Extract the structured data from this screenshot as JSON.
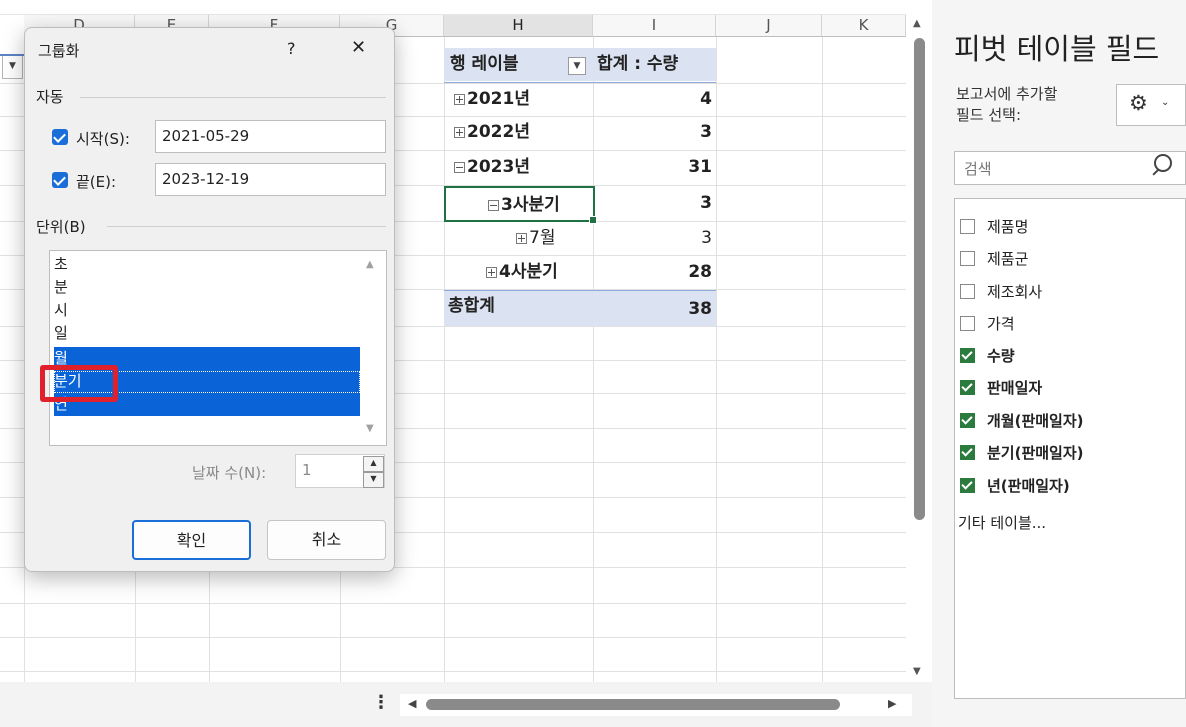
{
  "sheet": {
    "columns": [
      "D",
      "E",
      "F",
      "G",
      "H",
      "I",
      "J",
      "K"
    ],
    "pivot": {
      "header_row_label": "행 레이블",
      "header_sum_label": "합계 : 수량",
      "rows": [
        {
          "label": "2021년",
          "value": "4"
        },
        {
          "label": "2022년",
          "value": "3"
        },
        {
          "label": "2023년",
          "value": "31"
        },
        {
          "label": "3사분기",
          "value": "3"
        },
        {
          "label": "7월",
          "value": "3"
        },
        {
          "label": "4사분기",
          "value": "28"
        }
      ],
      "total_label": "총합계",
      "total_value": "38"
    }
  },
  "dialog": {
    "title": "그룹화",
    "help": "?",
    "close": "✕",
    "auto_section": "자동",
    "start_label": "시작(S):",
    "start_value": "2021-05-29",
    "end_label": "끝(E):",
    "end_value": "2023-12-19",
    "unit_section": "단위(B)",
    "units": [
      {
        "label": "초",
        "selected": false
      },
      {
        "label": "분",
        "selected": false
      },
      {
        "label": "시",
        "selected": false
      },
      {
        "label": "일",
        "selected": false
      },
      {
        "label": "월",
        "selected": true
      },
      {
        "label": "분기",
        "selected": true
      },
      {
        "label": "연",
        "selected": true
      }
    ],
    "days_label": "날짜 수(N):",
    "days_value": "1",
    "ok_label": "확인",
    "cancel_label": "취소",
    "highlight_color": "#e0202a"
  },
  "panel": {
    "title": "피벗 테이블 필드",
    "subtitle_line1": "보고서에 추가할",
    "subtitle_line2": "필드 선택:",
    "search_placeholder": "검색",
    "fields": [
      {
        "label": "제품명",
        "checked": false
      },
      {
        "label": "제품군",
        "checked": false
      },
      {
        "label": "제조회사",
        "checked": false
      },
      {
        "label": "가격",
        "checked": false
      },
      {
        "label": "수량",
        "checked": true
      },
      {
        "label": "판매일자",
        "checked": true
      },
      {
        "label": "개월(판매일자)",
        "checked": true
      },
      {
        "label": "분기(판매일자)",
        "checked": true
      },
      {
        "label": "년(판매일자)",
        "checked": true
      }
    ],
    "more_tables": "기타 테이블...",
    "accent_color": "#2c7b3e"
  }
}
